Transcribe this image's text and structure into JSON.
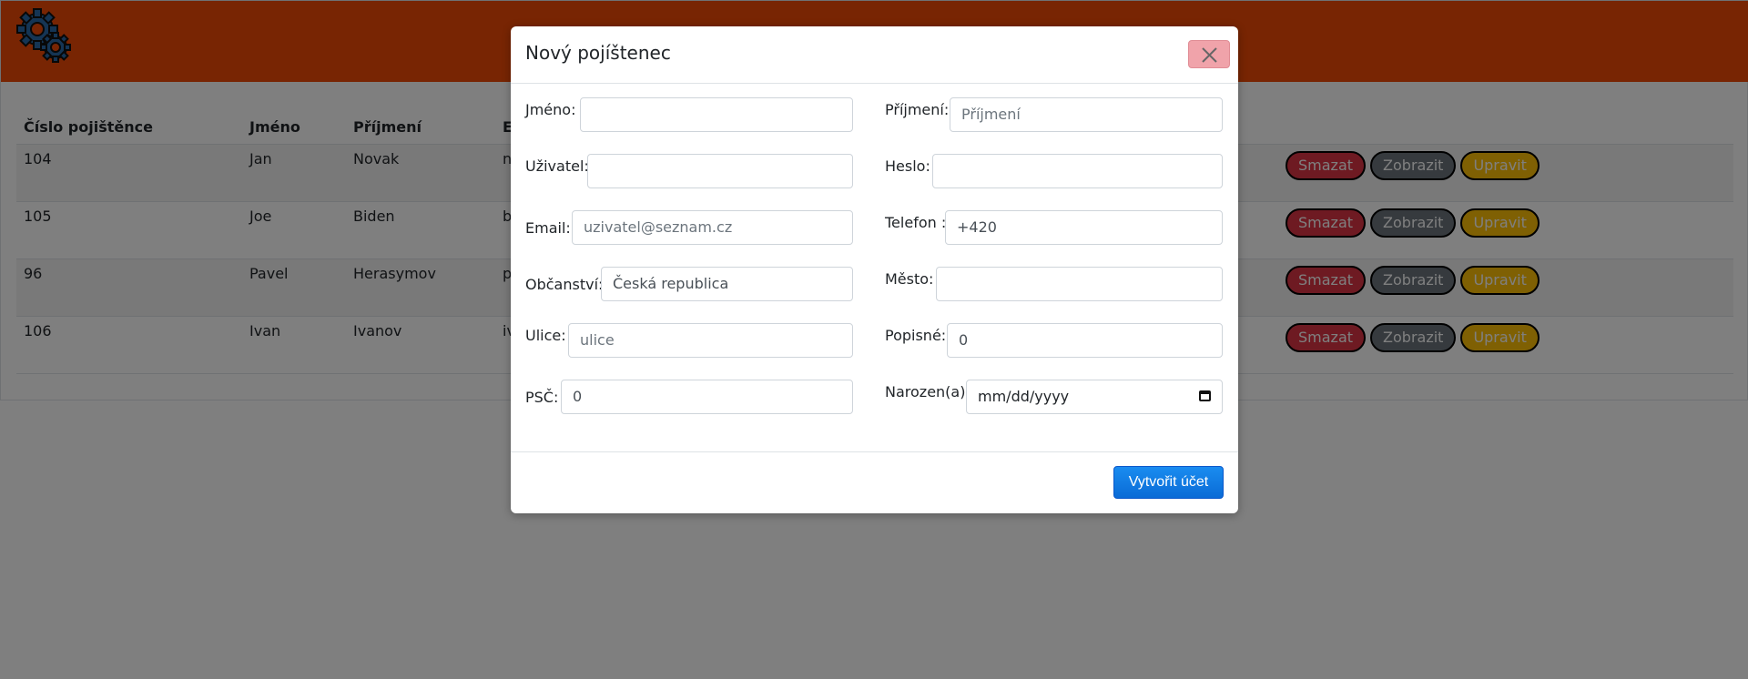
{
  "table": {
    "headers": [
      "Číslo pojištěnce",
      "Jméno",
      "Příjmení",
      "Em"
    ],
    "rows": [
      {
        "id": "104",
        "first": "Jan",
        "last": "Novak",
        "email": "nov"
      },
      {
        "id": "105",
        "first": "Joe",
        "last": "Biden",
        "email": "bide"
      },
      {
        "id": "96",
        "first": "Pavel",
        "last": "Herasymov",
        "email": "pav"
      },
      {
        "id": "106",
        "first": "Ivan",
        "last": "Ivanov",
        "email": "ivan"
      }
    ],
    "actions": {
      "delete": "Smazat",
      "show": "Zobrazit",
      "edit": "Upravit"
    }
  },
  "modal": {
    "title": "Nový pojíštenec",
    "fields": {
      "jmeno": {
        "label": "Jméno:",
        "value": ""
      },
      "prijmeni": {
        "label": "Příjmení:",
        "placeholder": "Příjmení"
      },
      "uzivatel": {
        "label": "Uživatel:",
        "value": ""
      },
      "heslo": {
        "label": "Heslo:",
        "value": ""
      },
      "email": {
        "label": "Email:",
        "placeholder": "uzivatel@seznam.cz"
      },
      "telefon": {
        "label": "Telefon :",
        "value": "+420"
      },
      "obcanstvi": {
        "label": "Občanství:",
        "value": "Česká republica"
      },
      "mesto": {
        "label": "Město:",
        "value": ""
      },
      "ulice": {
        "label": "Ulice:",
        "placeholder": "ulice"
      },
      "popisne": {
        "label": "Popisné:",
        "value": "0"
      },
      "psc": {
        "label": "PSČ:",
        "value": "0"
      },
      "narozen": {
        "label": "Narozen(a):",
        "value": "mm/dd/yyyy"
      }
    },
    "submit_label": "Vytvořit účet"
  },
  "colors": {
    "header": "#f04a07",
    "delete": "#dc3545",
    "show": "#6c757d",
    "edit": "#ffc107",
    "primary": "#0d6efd"
  }
}
